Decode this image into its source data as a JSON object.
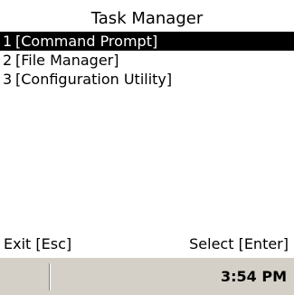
{
  "window": {
    "title": "Task Manager"
  },
  "tasks": [
    {
      "number": "1",
      "label": "[Command Prompt]",
      "selected": true
    },
    {
      "number": "2",
      "label": "[File Manager]",
      "selected": false
    },
    {
      "number": "3",
      "label": "[Configuration Utility]",
      "selected": false
    }
  ],
  "softkeys": {
    "left_label": "Exit [Esc]",
    "right_label": "Select [Enter]"
  },
  "taskbar": {
    "clock": "3:54 PM"
  },
  "colors": {
    "selection_bg": "#000000",
    "selection_fg": "#ffffff",
    "taskbar_bg": "#d4d0c8"
  }
}
